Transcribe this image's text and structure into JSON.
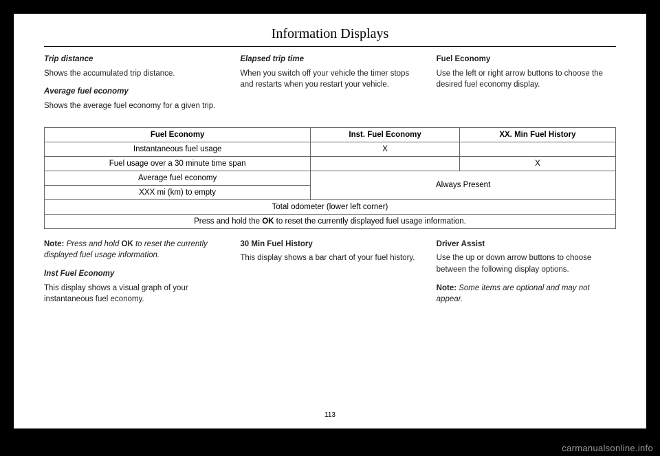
{
  "page_title": "Information Displays",
  "page_number": "113",
  "watermark": "carmanualsonline.info",
  "top": {
    "col1": {
      "h1": "Trip distance",
      "p1": "Shows the accumulated trip distance.",
      "h2": "Average fuel economy",
      "p2": "Shows the average fuel economy for a given trip."
    },
    "col2": {
      "h1": "Elapsed trip time",
      "p1": "When you switch off your vehicle the timer stops and restarts when you restart your vehicle."
    },
    "col3": {
      "h1": "Fuel Economy",
      "p1": "Use the left or right arrow buttons to choose the desired fuel economy display."
    }
  },
  "table": {
    "headers": {
      "c1": "Fuel Economy",
      "c2": "Inst. Fuel Economy",
      "c3": "XX. Min Fuel History"
    },
    "r1": {
      "c1": "Instantaneous fuel usage",
      "c2": "X",
      "c3": ""
    },
    "r2": {
      "c1": "Fuel usage over a 30 minute time span",
      "c2": "",
      "c3": "X"
    },
    "r3": {
      "c1": "Average fuel economy",
      "span": "Always Present"
    },
    "r4": {
      "c1": "XXX mi (km) to empty"
    },
    "r5": "Total odometer (lower left corner)",
    "r6_pre": "Press and hold the ",
    "r6_bold": "OK",
    "r6_post": " to reset the currently displayed fuel usage information."
  },
  "bottom": {
    "col1": {
      "note_pre": "Note:",
      "note_mid": " Press and hold ",
      "note_bold": "OK",
      "note_post": " to reset the currently displayed fuel usage information.",
      "h1": "Inst Fuel Economy",
      "p1": "This display shows a visual graph of your instantaneous fuel economy."
    },
    "col2": {
      "h1": "30 Min Fuel History",
      "p1": "This display shows a bar chart of your fuel history."
    },
    "col3": {
      "h1": "Driver Assist",
      "p1": "Use the up or down arrow buttons to choose between the following display options.",
      "note_pre": "Note:",
      "note_post": " Some items are optional and may not appear."
    }
  }
}
